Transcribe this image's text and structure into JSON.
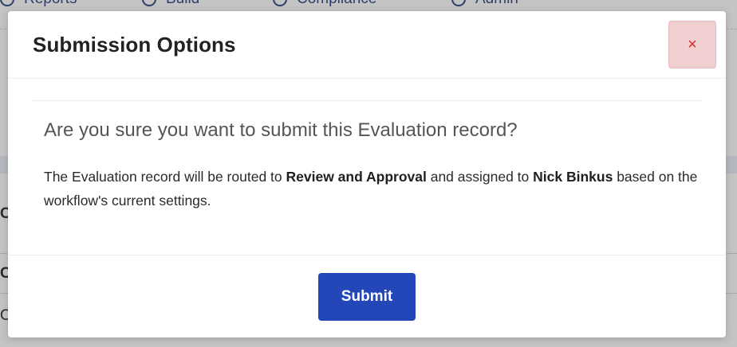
{
  "background_app": {
    "nav_items": [
      {
        "label": "Reports",
        "icon": "reports-icon"
      },
      {
        "label": "Build",
        "icon": "pencil-icon"
      },
      {
        "label": "Compliance",
        "icon": "compliance-icon"
      },
      {
        "label": "Admin",
        "icon": "gear-icon"
      }
    ],
    "partial_letters": [
      "C",
      "C",
      "C"
    ]
  },
  "modal": {
    "title": "Submission Options",
    "close_icon": "×",
    "question": "Are you sure you want to submit this Evaluation record?",
    "message": {
      "part1": "The Evaluation record will be routed to ",
      "bold1": "Review and Approval",
      "part2": " and assigned to ",
      "bold2": "Nick Binkus",
      "part3": " based on the workflow's current settings."
    },
    "submit_label": "Submit"
  },
  "colors": {
    "overlay": "#c4c4c4",
    "primary_button": "#2347b8",
    "close_button_bg": "#f0d0d0",
    "close_icon": "#d42a2a"
  }
}
